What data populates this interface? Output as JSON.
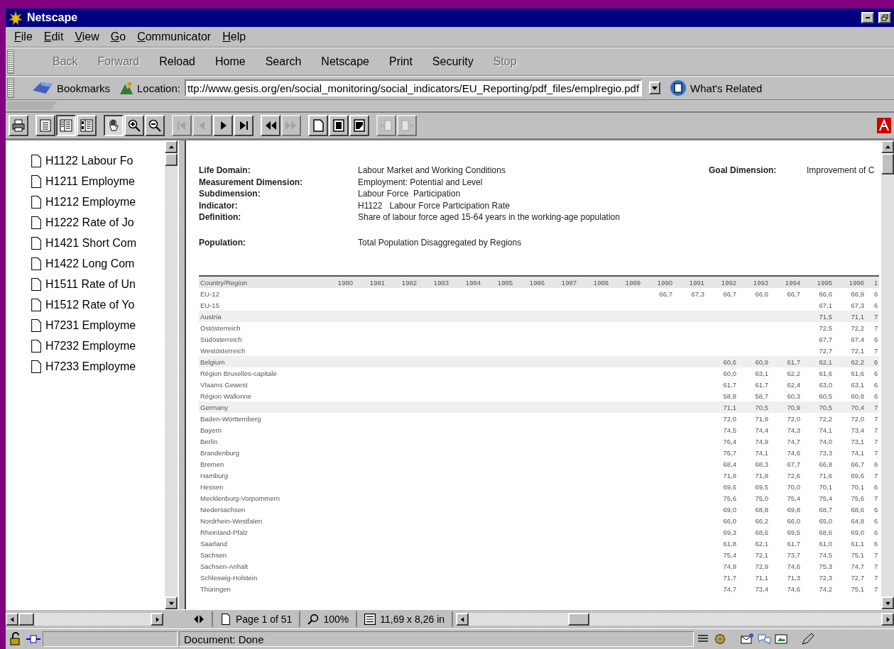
{
  "window": {
    "title": "Netscape"
  },
  "menu": [
    {
      "label": "File"
    },
    {
      "label": "Edit"
    },
    {
      "label": "View"
    },
    {
      "label": "Go"
    },
    {
      "label": "Communicator"
    },
    {
      "label": "Help"
    }
  ],
  "nav_toolbar": [
    {
      "label": "Back",
      "disabled": true
    },
    {
      "label": "Forward",
      "disabled": true
    },
    {
      "label": "Reload",
      "disabled": false
    },
    {
      "label": "Home",
      "disabled": false
    },
    {
      "label": "Search",
      "disabled": false
    },
    {
      "label": "Netscape",
      "disabled": false
    },
    {
      "label": "Print",
      "disabled": false
    },
    {
      "label": "Security",
      "disabled": false
    },
    {
      "label": "Stop",
      "disabled": true
    }
  ],
  "location_bar": {
    "bookmarks": "Bookmarks",
    "location_label": "Location:",
    "url": "ttp://www.gesis.org/en/social_monitoring/social_indicators/EU_Reporting/pdf_files/emplregio.pdf",
    "related": "What's Related"
  },
  "pdf_toolbar": [
    {
      "kind": "print",
      "disabled": false,
      "selected": false
    },
    {
      "kind": "page-only",
      "disabled": false,
      "selected": false
    },
    {
      "kind": "bookmarks-page",
      "disabled": false,
      "selected": true
    },
    {
      "kind": "thumbnails-page",
      "disabled": false,
      "selected": false
    },
    {
      "kind": "hand",
      "disabled": false,
      "selected": true
    },
    {
      "kind": "zoom-in",
      "disabled": false,
      "selected": false
    },
    {
      "kind": "zoom-out",
      "disabled": false,
      "selected": false
    },
    {
      "kind": "first",
      "disabled": true,
      "selected": false
    },
    {
      "kind": "prev",
      "disabled": true,
      "selected": false
    },
    {
      "kind": "next",
      "disabled": false,
      "selected": false
    },
    {
      "kind": "last",
      "disabled": false,
      "selected": false
    },
    {
      "kind": "back",
      "disabled": false,
      "selected": false
    },
    {
      "kind": "forward",
      "disabled": true,
      "selected": false
    },
    {
      "kind": "actual-size",
      "disabled": false,
      "selected": false
    },
    {
      "kind": "fit-page",
      "disabled": false,
      "selected": false
    },
    {
      "kind": "fit-width",
      "disabled": false,
      "selected": false
    },
    {
      "kind": "doc-left",
      "disabled": true,
      "selected": false
    },
    {
      "kind": "doc-right",
      "disabled": true,
      "selected": false
    }
  ],
  "bookmarks": [
    {
      "label": "H1122 Labour Fo"
    },
    {
      "label": "H1211 Employme"
    },
    {
      "label": "H1212 Employme"
    },
    {
      "label": "H1222 Rate of Jo"
    },
    {
      "label": "H1421 Short Com"
    },
    {
      "label": "H1422 Long Com"
    },
    {
      "label": "H1511 Rate of Un"
    },
    {
      "label": "H1512 Rate of Yo"
    },
    {
      "label": "H7231 Employme"
    },
    {
      "label": "H7232 Employme"
    },
    {
      "label": "H7233 Employme"
    }
  ],
  "document": {
    "fields": [
      {
        "label": "Life Domain:",
        "value": "Labour Market and Working Conditions"
      },
      {
        "label": "Measurement Dimension:",
        "value": "Employment: Potential and Level"
      },
      {
        "label": "Subdimension:",
        "value": "Labour Force  Participation"
      },
      {
        "label": "Indicator:",
        "value": "H1122   Labour Force Participation Rate"
      },
      {
        "label": "Definition:",
        "value": "Share of labour force aged 15-64 years in the working-age population"
      }
    ],
    "goal": {
      "label": "Goal Dimension:",
      "value": "Improvement of C"
    },
    "population": {
      "label": "Population:",
      "value": "Total Population Disaggregated by Regions"
    },
    "table": {
      "columns": [
        "Country/Region",
        "1980",
        "1981",
        "1982",
        "1983",
        "1984",
        "1985",
        "1986",
        "1987",
        "1988",
        "1989",
        "1990",
        "1991",
        "1992",
        "1993",
        "1994",
        "1995",
        "1996",
        "1"
      ],
      "rows": [
        {
          "name": "EU-12",
          "kind": "aggregate",
          "values": [
            "66,7",
            "67,3",
            "66,7",
            "66,6",
            "66,7",
            "66,6",
            "66,9",
            "6"
          ]
        },
        {
          "name": "EU-15",
          "kind": "aggregate",
          "values": [
            "67,1",
            "67,3",
            "6"
          ]
        },
        {
          "name": "Austria",
          "kind": "country",
          "values": [
            "71,5",
            "71,1",
            "7"
          ]
        },
        {
          "name": "Ostösterreich",
          "kind": "region",
          "values": [
            "72,5",
            "72,2",
            "7"
          ]
        },
        {
          "name": "Südösterreich",
          "kind": "region",
          "values": [
            "67,7",
            "67,4",
            "6"
          ]
        },
        {
          "name": "Westösterreich",
          "kind": "region",
          "values": [
            "72,7",
            "72,1",
            "7"
          ]
        },
        {
          "name": "Belgium",
          "kind": "country",
          "values": [
            "60,6",
            "60,9",
            "61,7",
            "62,1",
            "62,2",
            "6"
          ]
        },
        {
          "name": "Région Bruxelles-capitale",
          "kind": "region",
          "values": [
            "60,0",
            "63,1",
            "62,2",
            "61,6",
            "61,6",
            "6"
          ]
        },
        {
          "name": "Vlaams Gewest",
          "kind": "region",
          "values": [
            "61,7",
            "61,7",
            "62,4",
            "63,0",
            "63,1",
            "6"
          ]
        },
        {
          "name": "Région Wallonne",
          "kind": "region",
          "values": [
            "58,8",
            "58,7",
            "60,3",
            "60,5",
            "60,8",
            "6"
          ]
        },
        {
          "name": "Germany",
          "kind": "country",
          "values": [
            "71,1",
            "70,5",
            "70,9",
            "70,5",
            "70,4",
            "7"
          ]
        },
        {
          "name": "Baden-Württemberg",
          "kind": "region",
          "values": [
            "72,0",
            "71,9",
            "72,0",
            "72,2",
            "72,0",
            "7"
          ]
        },
        {
          "name": "Bayern",
          "kind": "region",
          "values": [
            "74,5",
            "74,4",
            "74,3",
            "74,1",
            "73,4",
            "7"
          ]
        },
        {
          "name": "Berlin",
          "kind": "region",
          "values": [
            "76,4",
            "74,9",
            "74,7",
            "74,0",
            "73,1",
            "7"
          ]
        },
        {
          "name": "Brandenburg",
          "kind": "region",
          "values": [
            "76,7",
            "74,1",
            "74,6",
            "73,3",
            "74,1",
            "7"
          ]
        },
        {
          "name": "Bremen",
          "kind": "region",
          "values": [
            "68,4",
            "68,3",
            "67,7",
            "66,8",
            "66,7",
            "6"
          ]
        },
        {
          "name": "Hamburg",
          "kind": "region",
          "values": [
            "71,8",
            "71,8",
            "72,6",
            "71,6",
            "69,6",
            "7"
          ]
        },
        {
          "name": "Hessen",
          "kind": "region",
          "values": [
            "69,6",
            "69,5",
            "70,0",
            "70,1",
            "70,1",
            "6"
          ]
        },
        {
          "name": "Mecklenburg-Vorpommern",
          "kind": "region",
          "values": [
            "75,6",
            "75,0",
            "75,4",
            "75,4",
            "75,6",
            "7"
          ]
        },
        {
          "name": "Niedersachsen",
          "kind": "region",
          "values": [
            "69,0",
            "68,8",
            "69,8",
            "68,7",
            "68,6",
            "6"
          ]
        },
        {
          "name": "Nordrhein-Westfalen",
          "kind": "region",
          "values": [
            "66,0",
            "66,2",
            "66,0",
            "65,0",
            "64,8",
            "6"
          ]
        },
        {
          "name": "Rheinland-Pfalz",
          "kind": "region",
          "values": [
            "69,3",
            "68,6",
            "69,5",
            "68,6",
            "69,0",
            "6"
          ]
        },
        {
          "name": "Saarland",
          "kind": "region",
          "values": [
            "61,8",
            "62,1",
            "61,7",
            "61,0",
            "61,1",
            "6"
          ]
        },
        {
          "name": "Sachsen",
          "kind": "region",
          "values": [
            "75,4",
            "72,1",
            "73,7",
            "74,5",
            "75,1",
            "7"
          ]
        },
        {
          "name": "Sachsen-Anhalt",
          "kind": "region",
          "values": [
            "74,9",
            "72,9",
            "74,6",
            "75,3",
            "74,7",
            "7"
          ]
        },
        {
          "name": "Schleswig-Holstein",
          "kind": "region",
          "values": [
            "71,7",
            "71,1",
            "71,3",
            "72,3",
            "72,7",
            "7"
          ]
        },
        {
          "name": "Thüringen",
          "kind": "region",
          "values": [
            "74,7",
            "73,4",
            "74,6",
            "74,2",
            "75,1",
            "7"
          ]
        }
      ]
    }
  },
  "pdf_status": {
    "page": "Page 1 of 51",
    "zoom": "100%",
    "size": "11,69 x 8,26 in"
  },
  "status_bar": {
    "text": "Document: Done"
  }
}
